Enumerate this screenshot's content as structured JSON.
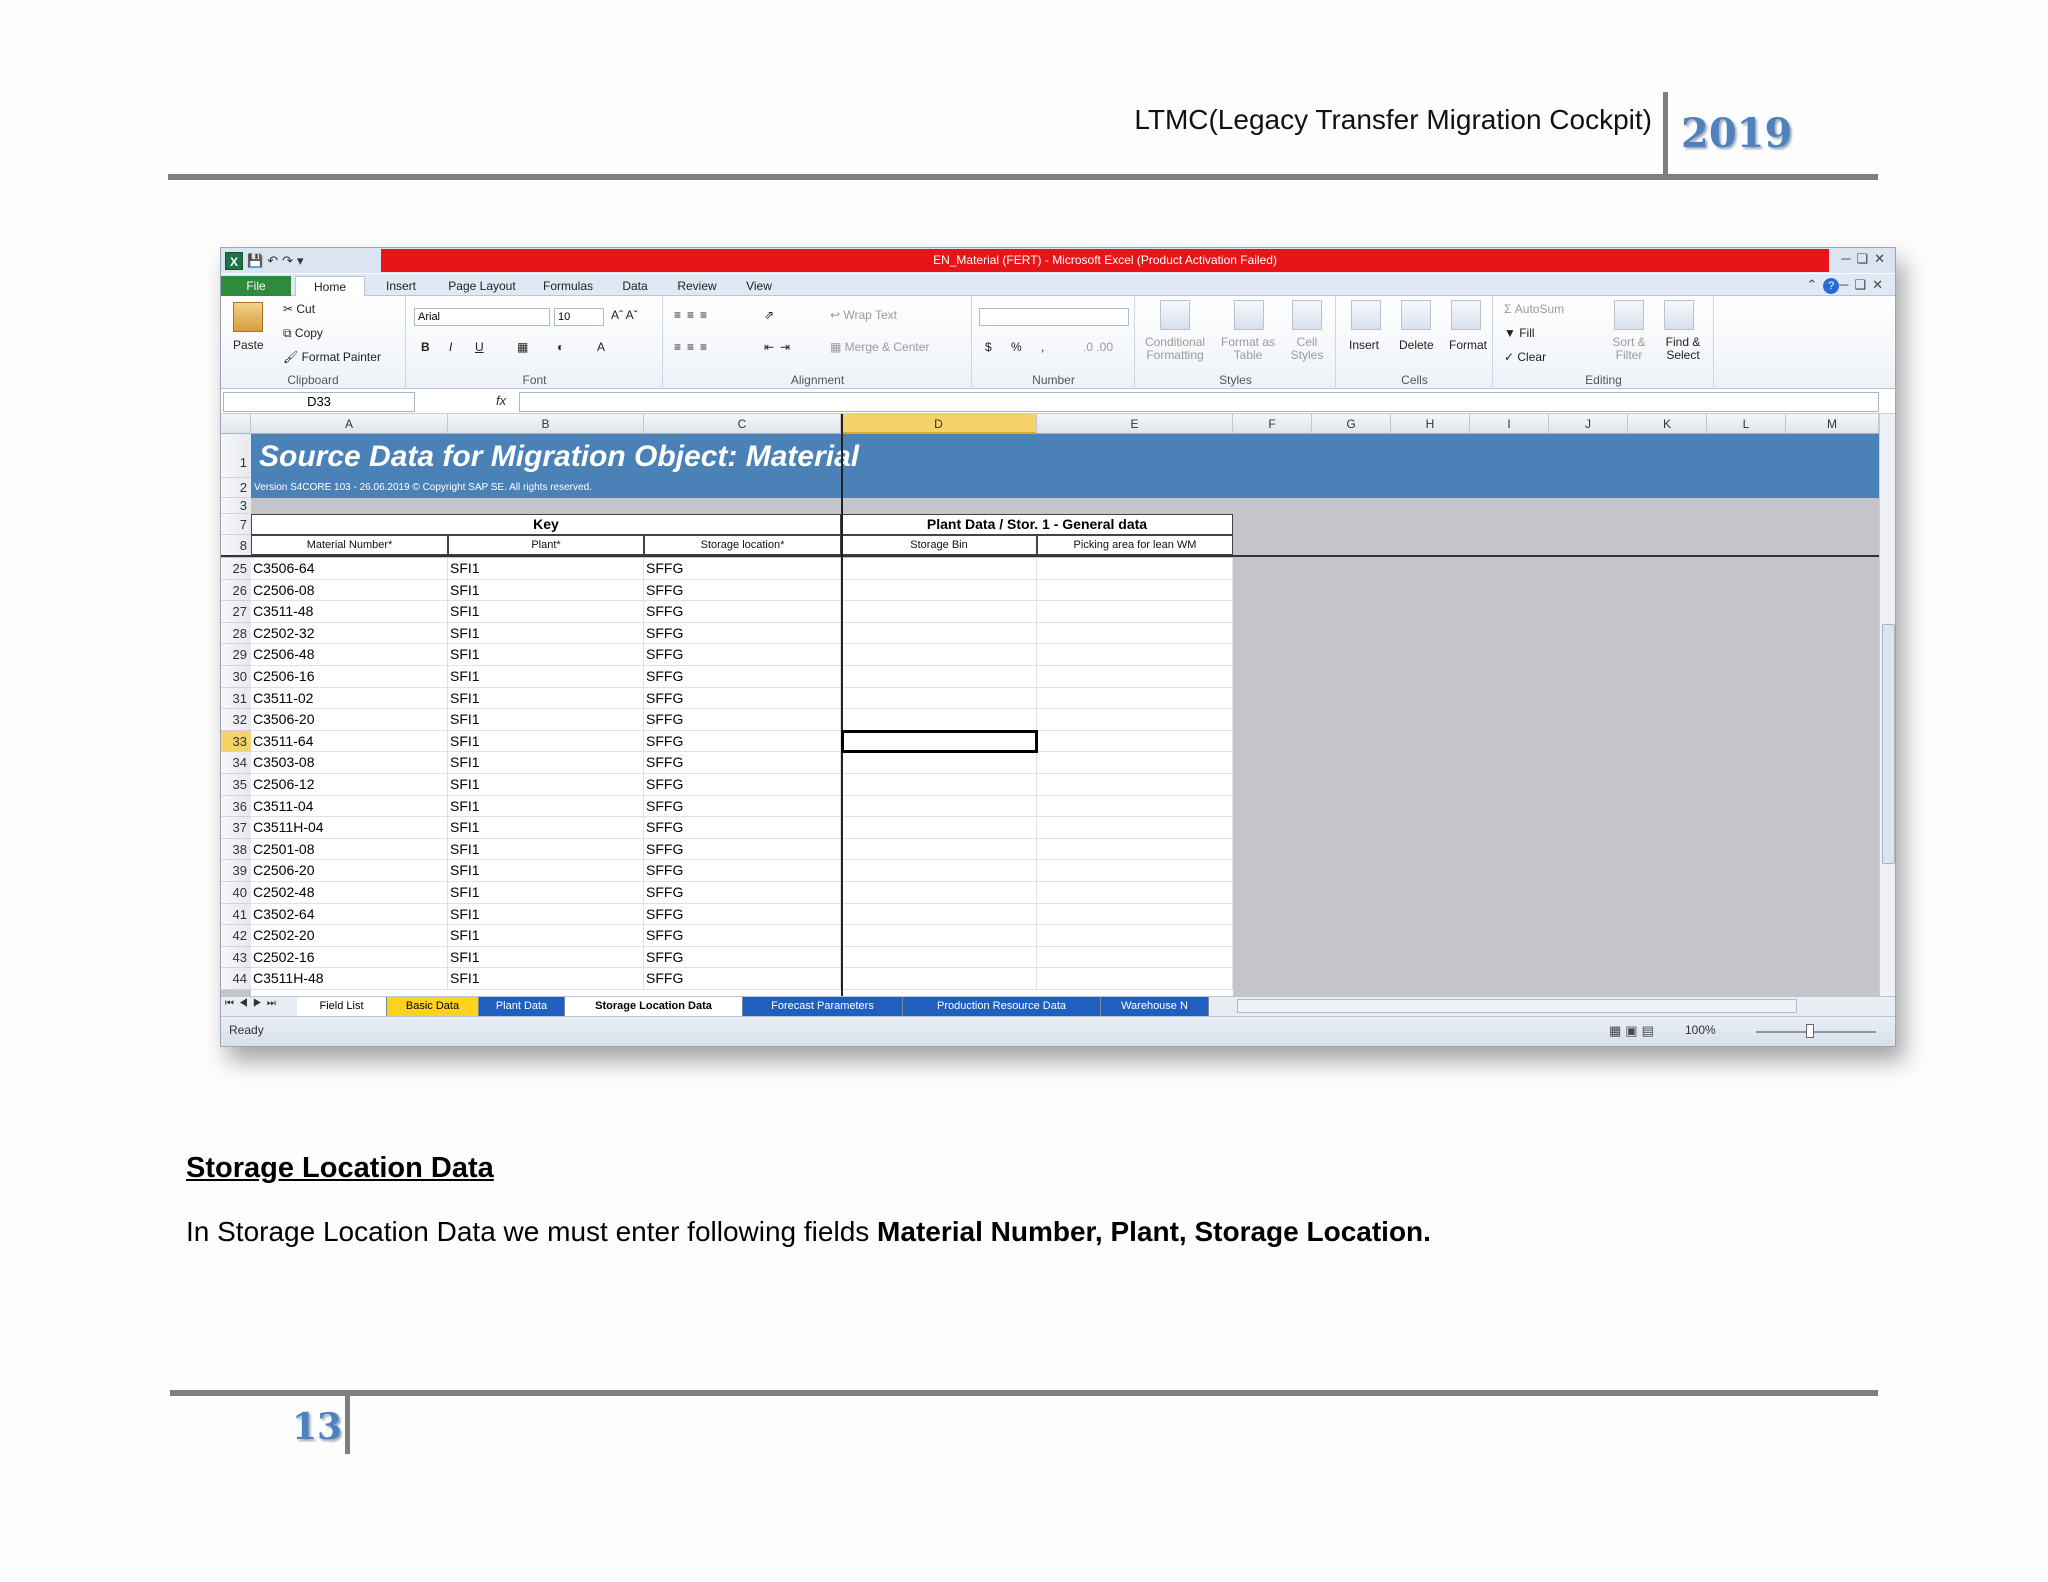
{
  "document": {
    "header_title": "LTMC(Legacy Transfer Migration Cockpit)",
    "header_year": "2019",
    "page_number": "13",
    "section_heading": "Storage Location Data",
    "section_body_prefix": "In Storage Location Data we must enter following fields ",
    "section_body_bold": "Material Number, Plant, Storage Location."
  },
  "excel": {
    "window_title": "EN_Material (FERT)  -  Microsoft Excel (Product Activation Failed)",
    "ribbon_tabs": [
      "File",
      "Home",
      "Insert",
      "Page Layout",
      "Formulas",
      "Data",
      "Review",
      "View"
    ],
    "clipboard": {
      "paste": "Paste",
      "cut": "Cut",
      "copy": "Copy",
      "format_painter": "Format Painter",
      "label": "Clipboard"
    },
    "font": {
      "name": "Arial",
      "size": "10",
      "label": "Font"
    },
    "alignment": {
      "wrap_text": "Wrap Text",
      "merge_center": "Merge & Center",
      "label": "Alignment"
    },
    "number": {
      "label": "Number"
    },
    "styles": {
      "conditional": "Conditional Formatting",
      "format_table": "Format as Table",
      "cell_styles": "Cell Styles",
      "label": "Styles"
    },
    "cells": {
      "insert": "Insert",
      "delete": "Delete",
      "format": "Format",
      "label": "Cells"
    },
    "editing": {
      "autosum": "AutoSum",
      "fill": "Fill",
      "clear": "Clear",
      "sort_filter": "Sort & Filter",
      "find_select": "Find & Select",
      "label": "Editing"
    },
    "name_box": "D33",
    "fx_label": "fx",
    "columns": [
      "A",
      "B",
      "C",
      "D",
      "E",
      "F",
      "G",
      "H",
      "I",
      "J",
      "K",
      "L",
      "M"
    ],
    "banner_title": "Source Data for Migration Object:  Material",
    "banner_version": "Version S4CORE 103 - 26.06.2019 © Copyright SAP SE. All rights reserved.",
    "group_key": "Key",
    "group_plant": "Plant Data / Stor. 1 - General data",
    "field_headers": [
      "Material Number*",
      "Plant*",
      "Storage location*",
      "Storage Bin",
      "Picking area for lean WM"
    ],
    "header_row_numbers": [
      "1",
      "2",
      "3",
      "7",
      "8"
    ],
    "rows": [
      {
        "num": "25",
        "material": "C3506-64",
        "plant": "SFI1",
        "sloc": "SFFG"
      },
      {
        "num": "26",
        "material": "C2506-08",
        "plant": "SFI1",
        "sloc": "SFFG"
      },
      {
        "num": "27",
        "material": "C3511-48",
        "plant": "SFI1",
        "sloc": "SFFG"
      },
      {
        "num": "28",
        "material": "C2502-32",
        "plant": "SFI1",
        "sloc": "SFFG"
      },
      {
        "num": "29",
        "material": "C2506-48",
        "plant": "SFI1",
        "sloc": "SFFG"
      },
      {
        "num": "30",
        "material": "C2506-16",
        "plant": "SFI1",
        "sloc": "SFFG"
      },
      {
        "num": "31",
        "material": "C3511-02",
        "plant": "SFI1",
        "sloc": "SFFG"
      },
      {
        "num": "32",
        "material": "C3506-20",
        "plant": "SFI1",
        "sloc": "SFFG"
      },
      {
        "num": "33",
        "material": "C3511-64",
        "plant": "SFI1",
        "sloc": "SFFG"
      },
      {
        "num": "34",
        "material": "C3503-08",
        "plant": "SFI1",
        "sloc": "SFFG"
      },
      {
        "num": "35",
        "material": "C2506-12",
        "plant": "SFI1",
        "sloc": "SFFG"
      },
      {
        "num": "36",
        "material": "C3511-04",
        "plant": "SFI1",
        "sloc": "SFFG"
      },
      {
        "num": "37",
        "material": "C3511H-04",
        "plant": "SFI1",
        "sloc": "SFFG"
      },
      {
        "num": "38",
        "material": "C2501-08",
        "plant": "SFI1",
        "sloc": "SFFG"
      },
      {
        "num": "39",
        "material": "C2506-20",
        "plant": "SFI1",
        "sloc": "SFFG"
      },
      {
        "num": "40",
        "material": "C2502-48",
        "plant": "SFI1",
        "sloc": "SFFG"
      },
      {
        "num": "41",
        "material": "C3502-64",
        "plant": "SFI1",
        "sloc": "SFFG"
      },
      {
        "num": "42",
        "material": "C2502-20",
        "plant": "SFI1",
        "sloc": "SFFG"
      },
      {
        "num": "43",
        "material": "C2502-16",
        "plant": "SFI1",
        "sloc": "SFFG"
      },
      {
        "num": "44",
        "material": "C3511H-48",
        "plant": "SFI1",
        "sloc": "SFFG"
      }
    ],
    "active_row": "33",
    "active_column": "D",
    "sheet_tabs": [
      {
        "label": "Field List",
        "color": "#ffffff"
      },
      {
        "label": "Basic Data",
        "color": "#ffd21f"
      },
      {
        "label": "Plant Data",
        "color": "#1f5fbf"
      },
      {
        "label": "Storage Location Data",
        "color": "#ffffff"
      },
      {
        "label": "Forecast Parameters",
        "color": "#1f5fbf"
      },
      {
        "label": "Production Resource Data",
        "color": "#1f5fbf"
      },
      {
        "label": "Warehouse N",
        "color": "#1f5fbf"
      }
    ],
    "active_sheet": "Storage Location Data",
    "status": "Ready",
    "zoom": "100%",
    "colors": {
      "banner": "#4a81b7",
      "title_bar": "#e8141a",
      "selected_header": "#f6d26b"
    }
  }
}
